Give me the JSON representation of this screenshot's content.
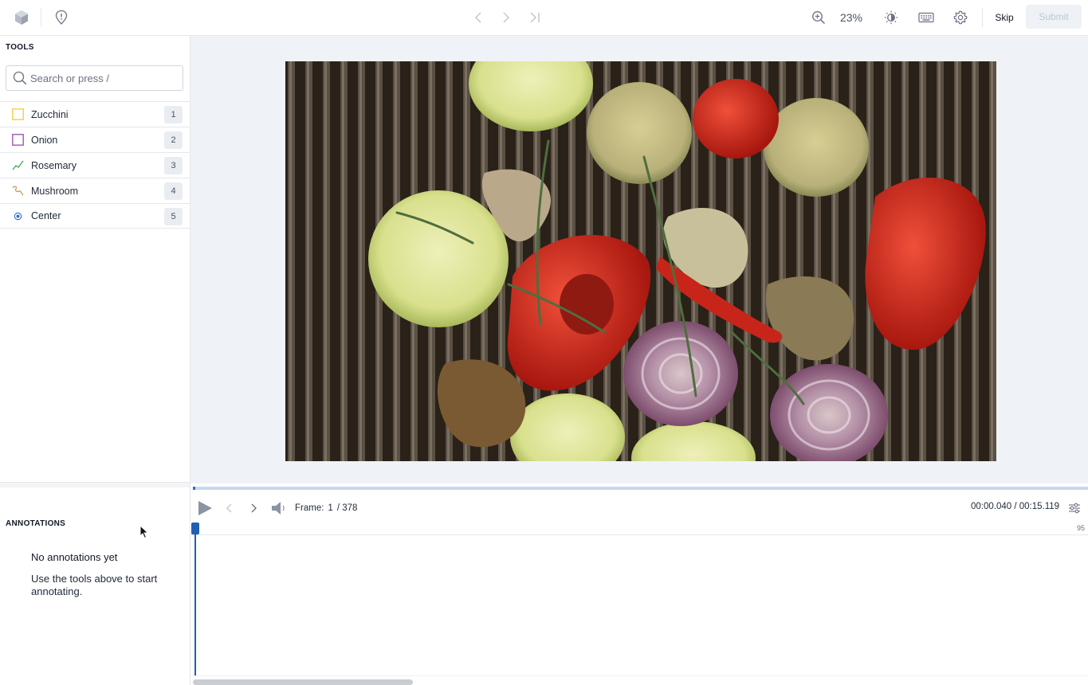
{
  "topbar": {
    "zoom_value": "23%",
    "skip_label": "Skip",
    "submit_label": "Submit"
  },
  "tools": {
    "title": "TOOLS",
    "search_placeholder": "Search or press /",
    "items": [
      {
        "label": "Zucchini",
        "shortcut": "1",
        "icon": "bounding-box-icon",
        "color": "#f2d04a"
      },
      {
        "label": "Onion",
        "shortcut": "2",
        "icon": "bounding-box-icon",
        "color": "#9b59b6"
      },
      {
        "label": "Rosemary",
        "shortcut": "3",
        "icon": "polyline-icon",
        "color": "#3aa64b"
      },
      {
        "label": "Mushroom",
        "shortcut": "4",
        "icon": "freehand-icon",
        "color": "#c79a5e"
      },
      {
        "label": "Center",
        "shortcut": "5",
        "icon": "point-icon",
        "color": "#2f6fd0"
      }
    ]
  },
  "annotations": {
    "title": "ANNOTATIONS",
    "empty_title": "No annotations yet",
    "empty_desc": "Use the tools above to start annotating."
  },
  "timeline": {
    "frame_label": "Frame:",
    "frame_current": "1",
    "frame_total": "/ 378",
    "time": "00:00.040 / 00:15.119",
    "ruler_number": "95"
  },
  "colors": {
    "accent": "#1e5fb3",
    "canvas_bg": "#eff2f6"
  }
}
